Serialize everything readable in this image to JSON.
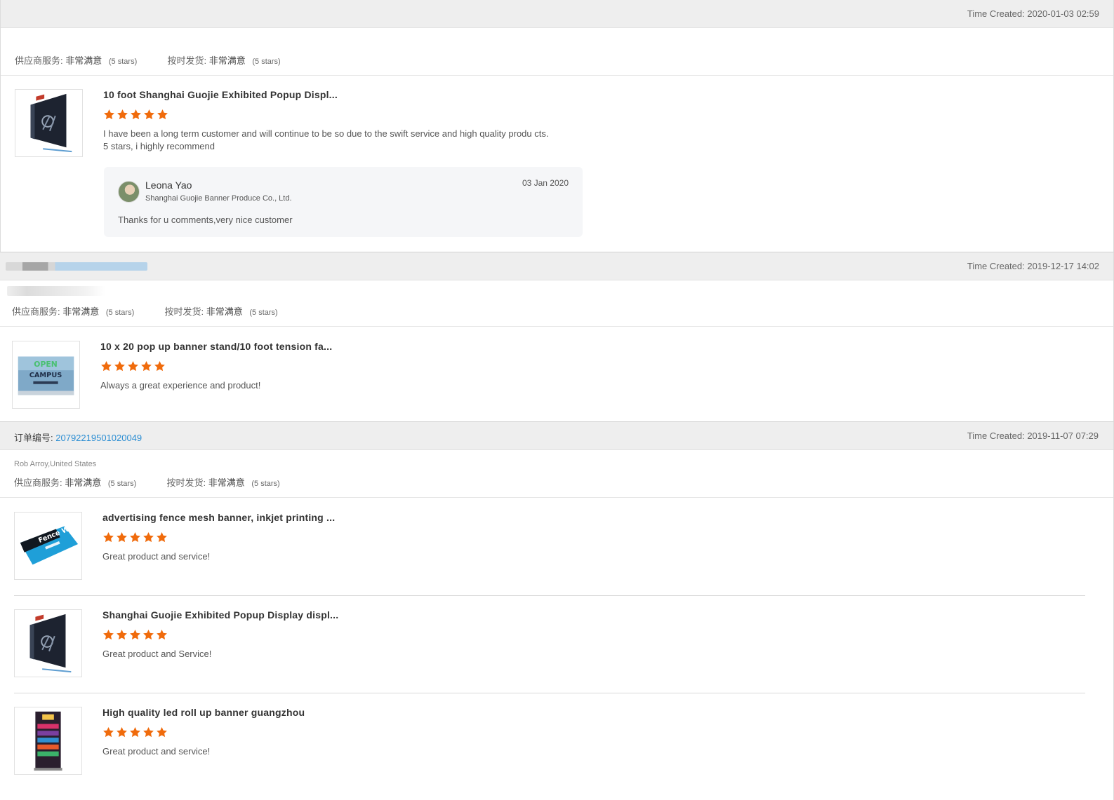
{
  "colors": {
    "star": "#f06b0c",
    "order_link": "#2c8ed3",
    "header_bg": "#eeeeee"
  },
  "labels": {
    "time_created_prefix": "Time Created:",
    "supplier_service": "供应商服务:",
    "on_time_delivery": "按时发货:",
    "order_no": "订单编号:"
  },
  "reviews": [
    {
      "time_created": "Time Created: 2020-01-03 02:59",
      "supplier_service_value": "非常满意",
      "supplier_service_stars": "(5 stars)",
      "delivery_value": "非常满意",
      "delivery_stars": "(5 stars)",
      "products": [
        {
          "title": "10 foot Shanghai Guojie Exhibited Popup Displ...",
          "rating": 5,
          "comment": "I have been a long term customer and will continue to be so due to the swift service and high quality produ cts. 5 stars, i highly recommend",
          "thumb_icon": "black-popup-display-icon"
        }
      ],
      "reply": {
        "name": "Leona Yao",
        "company": "Shanghai Guojie Banner Produce Co., Ltd.",
        "date": "03 Jan 2020",
        "text": "Thanks for u comments,very nice customer"
      }
    },
    {
      "time_created": "Time Created: 2019-12-17 14:02",
      "supplier_service_value": "非常满意",
      "supplier_service_stars": "(5 stars)",
      "delivery_value": "非常满意",
      "delivery_stars": "(5 stars)",
      "products": [
        {
          "title": "10 x 20 pop up banner stand/10 foot tension fa...",
          "rating": 5,
          "comment": "Always a great experience and product!",
          "thumb_icon": "open-campus-banner-icon"
        }
      ]
    },
    {
      "order_no_label": "订单编号:",
      "order_no": "20792219501020049",
      "time_created": "Time Created: 2019-11-07 07:29",
      "buyer": "Rob Arroy,United States",
      "supplier_service_value": "非常满意",
      "supplier_service_stars": "(5 stars)",
      "delivery_value": "非常满意",
      "delivery_stars": "(5 stars)",
      "products": [
        {
          "title": "advertising fence mesh banner, inkjet printing ...",
          "rating": 5,
          "comment": "Great product and service!",
          "thumb_icon": "fence-wrap-banner-icon"
        },
        {
          "title": "Shanghai Guojie Exhibited Popup Display displ...",
          "rating": 5,
          "comment": "Great product and Service!",
          "thumb_icon": "black-popup-display-icon"
        },
        {
          "title": "High quality led roll up banner guangzhou",
          "rating": 5,
          "comment": "Great product and service!",
          "thumb_icon": "roll-up-banner-icon"
        }
      ]
    }
  ]
}
